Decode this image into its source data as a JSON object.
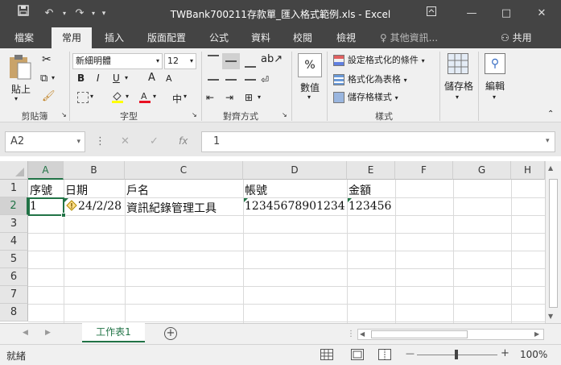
{
  "window": {
    "title": "TWBank700211存款單_匯入格式範例.xls - Excel",
    "quick_access": {
      "save_icon": "save-icon",
      "undo_icon": "undo-icon",
      "redo_icon": "redo-icon"
    },
    "controls": {
      "minimize": "—",
      "maximize": "□",
      "close": "✕"
    }
  },
  "ribbon_tabs": [
    {
      "label": "檔案",
      "active": false
    },
    {
      "label": "常用",
      "active": true
    },
    {
      "label": "插入",
      "active": false
    },
    {
      "label": "版面配置",
      "active": false
    },
    {
      "label": "公式",
      "active": false
    },
    {
      "label": "資料",
      "active": false
    },
    {
      "label": "校閱",
      "active": false
    },
    {
      "label": "檢視",
      "active": false
    }
  ],
  "tell_me": "其他資訊...",
  "share": "共用",
  "ribbon": {
    "clipboard": {
      "paste": "貼上",
      "group": "剪貼簿"
    },
    "font": {
      "name": "新細明體",
      "size": "12",
      "group": "字型",
      "bold": "B",
      "italic": "I",
      "underline": "U",
      "grow": "A",
      "shrink": "A",
      "phonetic": "中"
    },
    "alignment": {
      "group": "對齊方式"
    },
    "number": {
      "percent": "%",
      "label": "數值"
    },
    "styles": {
      "conditional": "設定格式化的條件",
      "table": "格式化為表格",
      "cell": "儲存格樣式",
      "group": "樣式"
    },
    "cells": {
      "label": "儲存格"
    },
    "editing": {
      "label": "編輯"
    }
  },
  "formula_bar": {
    "name_box": "A2",
    "content": "1",
    "cancel": "✕",
    "enter": "✓",
    "fx": "fx"
  },
  "grid": {
    "columns": [
      "A",
      "B",
      "C",
      "D",
      "E",
      "F",
      "G",
      "H"
    ],
    "rows": [
      "1",
      "2",
      "3",
      "4",
      "5",
      "6",
      "7",
      "8"
    ],
    "cells": [
      [
        "序號",
        "日期",
        "戶名",
        "帳號",
        "金額"
      ],
      [
        "1",
        "24/2/28",
        "資訊紀錄管理工具",
        "12345678901234",
        "123456"
      ]
    ],
    "selected": "A2"
  },
  "sheet_tabs": [
    {
      "label": "工作表1",
      "active": true
    }
  ],
  "add_sheet": "+",
  "status": {
    "ready": "就緒",
    "zoom": "100%",
    "zoom_minus": "—",
    "zoom_plus": "+"
  },
  "colors": {
    "accent": "#217346",
    "titlebar": "#444444"
  }
}
